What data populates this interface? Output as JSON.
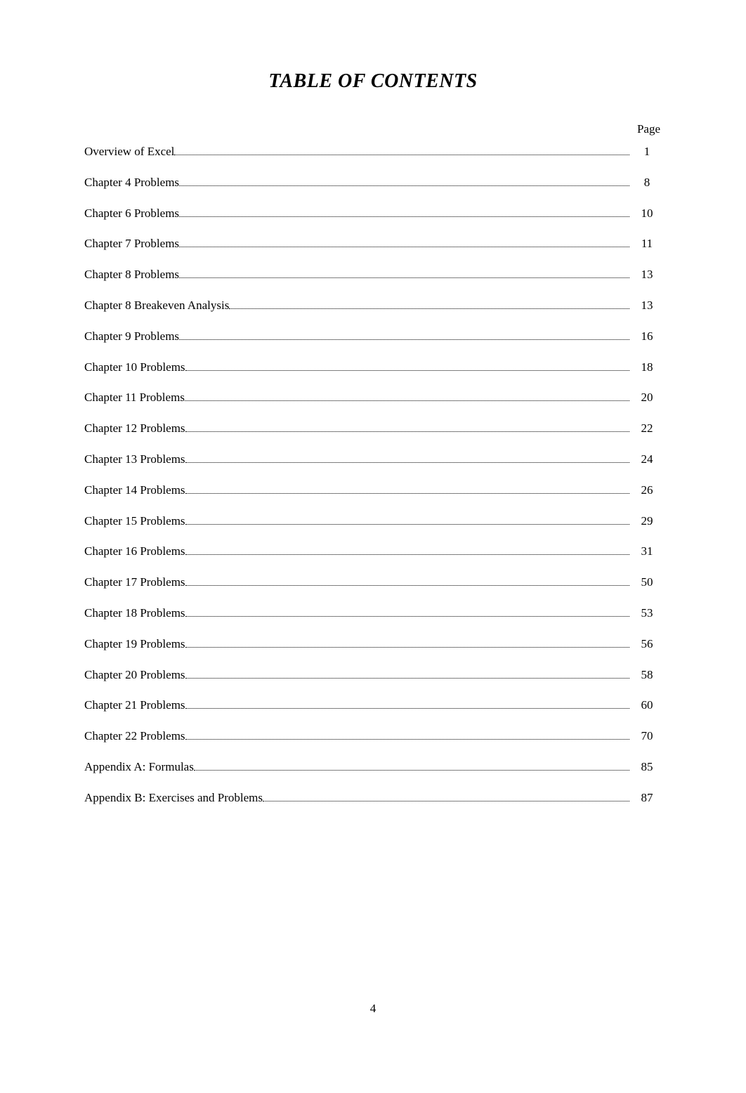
{
  "title": "TABLE OF CONTENTS",
  "page_column_header": "Page",
  "footer_page_number": "4",
  "entries": [
    {
      "label": "Overview of Excel",
      "page": "1"
    },
    {
      "label": "Chapter 4 Problems",
      "page": "8"
    },
    {
      "label": "Chapter 6 Problems",
      "page": "10"
    },
    {
      "label": "Chapter 7 Problems",
      "page": "11"
    },
    {
      "label": "Chapter 8 Problems",
      "page": "13"
    },
    {
      "label": "Chapter 8 Breakeven Analysis",
      "page": "13"
    },
    {
      "label": "Chapter 9 Problems",
      "page": "16"
    },
    {
      "label": "Chapter 10 Problems",
      "page": "18"
    },
    {
      "label": "Chapter 11 Problems",
      "page": "20"
    },
    {
      "label": "Chapter 12 Problems",
      "page": "22"
    },
    {
      "label": "Chapter 13 Problems",
      "page": "24"
    },
    {
      "label": "Chapter 14 Problems",
      "page": "26"
    },
    {
      "label": "Chapter 15 Problems",
      "page": "29"
    },
    {
      "label": "Chapter 16 Problems",
      "page": "31"
    },
    {
      "label": "Chapter 17 Problems",
      "page": "50"
    },
    {
      "label": "Chapter 18 Problems",
      "page": "53"
    },
    {
      "label": "Chapter 19 Problems",
      "page": "56"
    },
    {
      "label": "Chapter 20 Problems",
      "page": "58"
    },
    {
      "label": "Chapter 21 Problems",
      "page": "60"
    },
    {
      "label": "Chapter 22 Problems",
      "page": "70"
    },
    {
      "label": "Appendix A: Formulas",
      "page": "85"
    },
    {
      "label": "Appendix B: Exercises and Problems",
      "page": "87"
    }
  ]
}
